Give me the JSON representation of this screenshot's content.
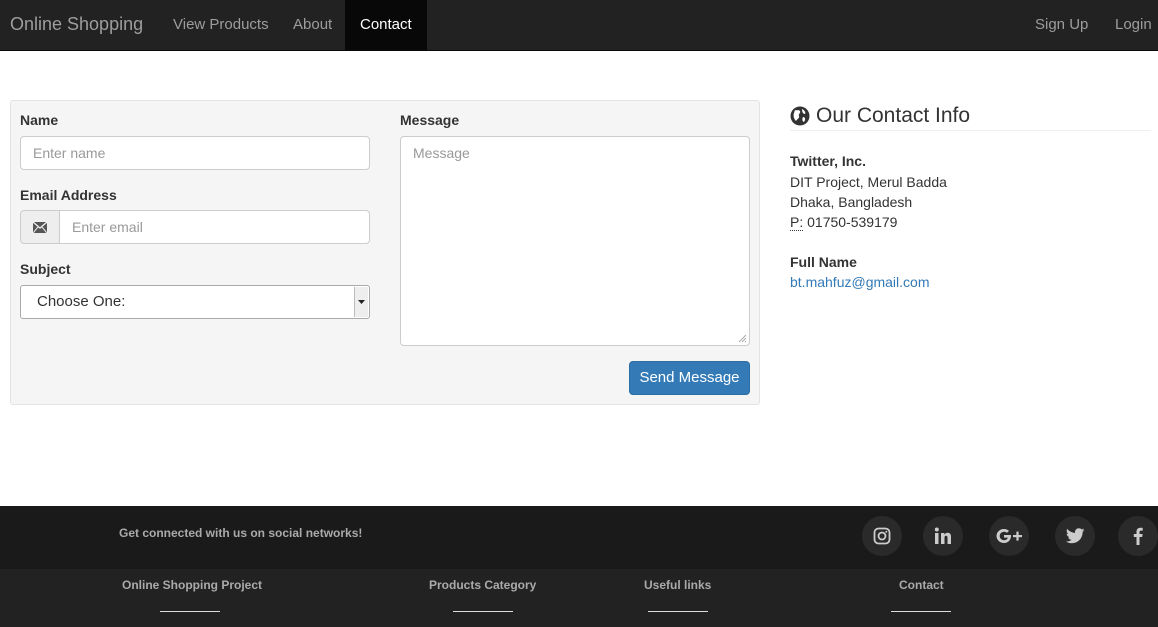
{
  "navbar": {
    "brand": "Online Shopping",
    "links": [
      "View Products",
      "About",
      "Contact"
    ],
    "active": "Contact",
    "right_links": [
      "Sign Up",
      "Login"
    ]
  },
  "form": {
    "name_label": "Name",
    "name_placeholder": "Enter name",
    "email_label": "Email Address",
    "email_placeholder": "Enter email",
    "subject_label": "Subject",
    "subject_selected": "Choose One:",
    "message_label": "Message",
    "message_placeholder": "Message",
    "send_button": "Send Message"
  },
  "contact_info": {
    "title": "Our Contact Info",
    "company": "Twitter, Inc.",
    "address_line1": "DIT Project, Merul Badda",
    "address_line2": "Dhaka, Bangladesh",
    "phone_prefix": "P:",
    "phone": "01750-539179",
    "person_name": "Full Name",
    "email": "bt.mahfuz@gmail.com"
  },
  "footer": {
    "social_text": "Get connected with us on social networks!",
    "social_icons": [
      "instagram-icon",
      "linkedin-icon",
      "google-plus-icon",
      "twitter-icon",
      "facebook-icon"
    ],
    "sections": [
      "Online Shopping Project",
      "Products Category",
      "Useful links",
      "Contact"
    ]
  },
  "colors": {
    "navbar_bg": "#222222",
    "primary_button": "#337ab7",
    "link": "#337ab7"
  }
}
